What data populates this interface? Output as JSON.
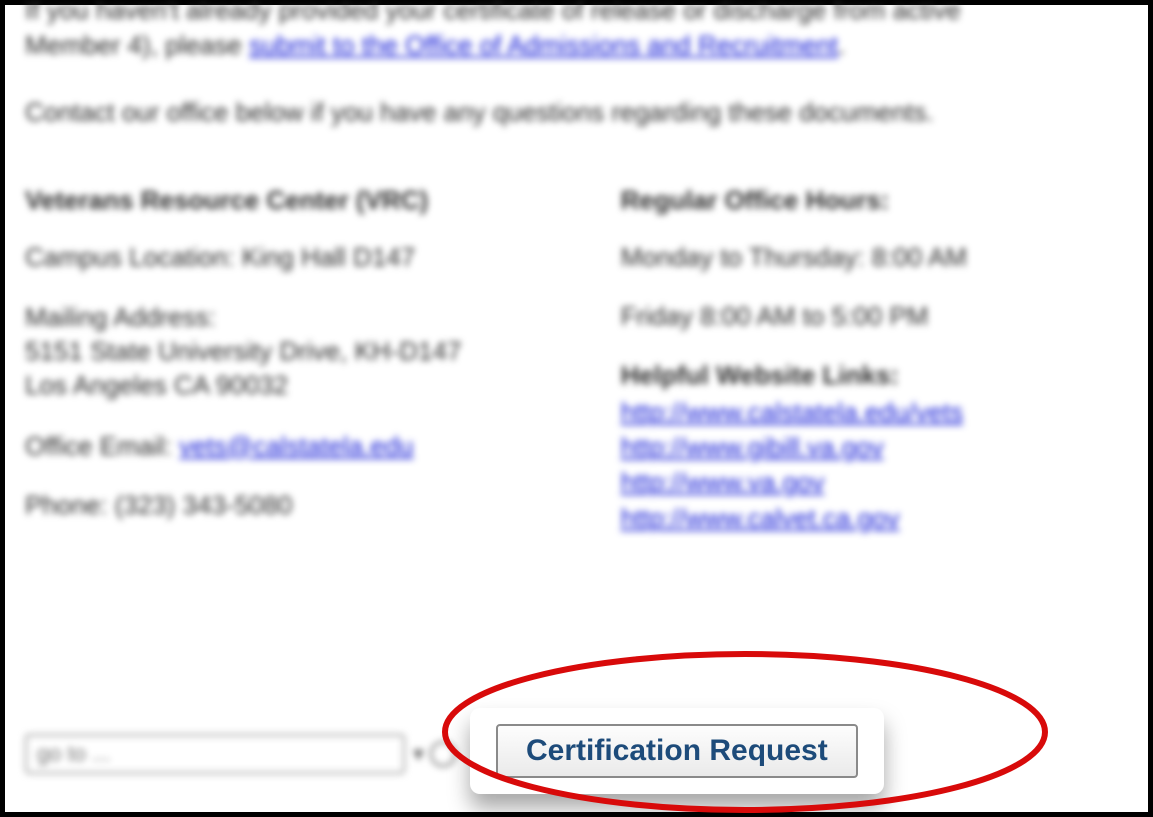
{
  "top": {
    "line1_prefix": "If you haven't already provided your certificate of release or discharge from active",
    "line2_prefix": "Member 4), please ",
    "line2_link": "submit to the Office of Admissions and Recruitment",
    "line2_suffix": ".",
    "contact_line": "Contact our office below if you have any questions regarding these documents."
  },
  "left": {
    "title": "Veterans Resource Center (VRC)",
    "campus_label": "Campus Location: King Hall D147",
    "mailing_label": "Mailing Address:",
    "mailing_line1": "5151 State University Drive, KH-D147",
    "mailing_line2": "Los Angeles CA 90032",
    "email_label": "Office Email: ",
    "email_link": "vets@calstatela.edu",
    "phone_label": "Phone: (323) 343-5080"
  },
  "right": {
    "hours_title": "Regular Office Hours:",
    "hours_line1": "Monday to Thursday: 8:00 AM",
    "hours_line2": "Friday 8:00 AM to 5:00 PM",
    "links_title": "Helpful Website Links:",
    "links": [
      "http://www.calstatela.edu/vets",
      "http://www.gibill.va.gov",
      "http://www.va.gov",
      "http://www.calvet.ca.gov"
    ]
  },
  "bottom": {
    "goto_placeholder": "go to ...",
    "cert_button": "Certification Request"
  }
}
